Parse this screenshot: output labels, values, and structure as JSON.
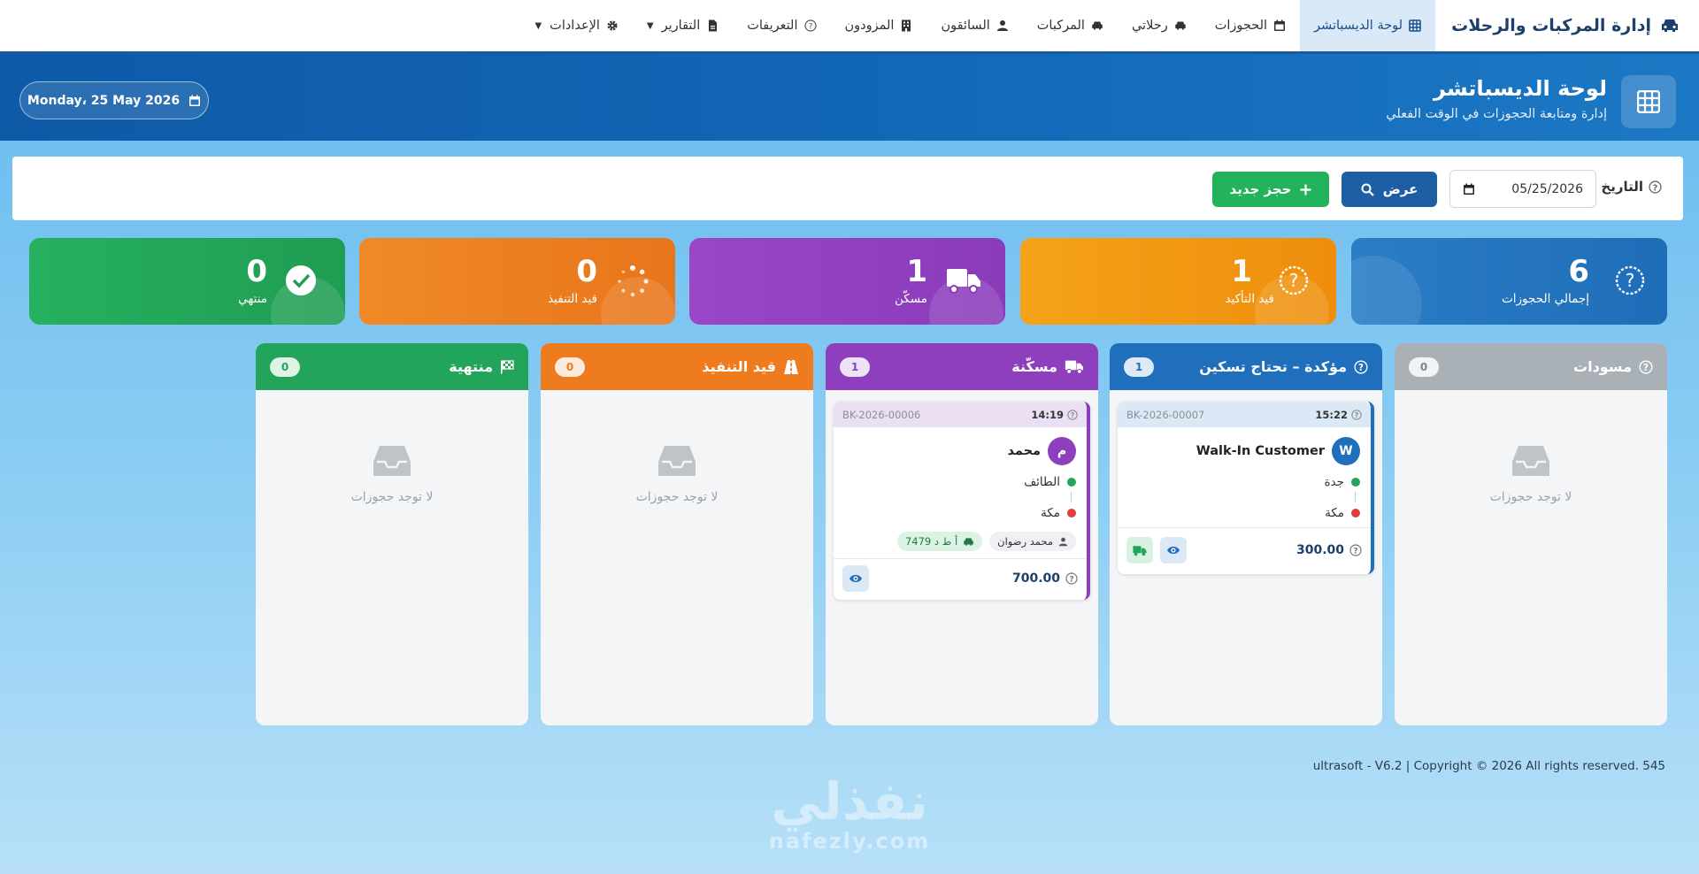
{
  "app": {
    "brand": "إدارة المركبات والرحلات",
    "nav": [
      {
        "label": "لوحة الديسباتشر",
        "icon": "grid-icon",
        "active": true
      },
      {
        "label": "الحجوزات",
        "icon": "calendar-icon"
      },
      {
        "label": "رحلاتي",
        "icon": "car-icon"
      },
      {
        "label": "المركبات",
        "icon": "car-icon"
      },
      {
        "label": "السائقون",
        "icon": "user-icon"
      },
      {
        "label": "المزودون",
        "icon": "building-icon"
      },
      {
        "label": "التعريفات",
        "icon": "question-icon"
      },
      {
        "label": "التقارير",
        "icon": "file-icon",
        "dropdown": true
      },
      {
        "label": "الإعدادات",
        "icon": "gear-icon",
        "dropdown": true
      }
    ]
  },
  "header": {
    "title": "لوحة الديسباتشر",
    "subtitle": "إدارة ومتابعة الحجوزات في الوقت الفعلي",
    "date": "Monday، 25 May 2026"
  },
  "filter": {
    "label": "التاريخ",
    "date_value": "05/25/2026",
    "show_button": "عرض",
    "new_button": "حجز جديد"
  },
  "stats": [
    {
      "value": "6",
      "label": "إجمالي الحجوزات",
      "color": "#1e73be",
      "icon": "question-circle-icon"
    },
    {
      "value": "1",
      "label": "قيد التأكيد",
      "color": "#f0960f",
      "icon": "question-circle-icon"
    },
    {
      "value": "1",
      "label": "مسكّن",
      "color": "#8e3fbd",
      "icon": "truck-icon"
    },
    {
      "value": "0",
      "label": "قيد التنفيذ",
      "color": "#ee7b1d",
      "icon": "spinner-icon"
    },
    {
      "value": "0",
      "label": "منتهي",
      "color": "#22a55a",
      "icon": "check-circle-icon"
    }
  ],
  "columns": [
    {
      "title": "مسودات",
      "count": "0",
      "color": "#a7aeb4",
      "icon": "question-icon",
      "empty_text": "لا توجد حجوزات"
    },
    {
      "title": "مؤكدة – تحتاج تسكين",
      "count": "1",
      "color": "#1f6fbd",
      "icon": "question-icon"
    },
    {
      "title": "مسكّنة",
      "count": "1",
      "color": "#8e3fbd",
      "icon": "truck-icon"
    },
    {
      "title": "قيد التنفيذ",
      "count": "0",
      "color": "#ee7b1d",
      "icon": "road-icon",
      "empty_text": "لا توجد حجوزات"
    },
    {
      "title": "منتهية",
      "count": "0",
      "color": "#22a55a",
      "icon": "flag-icon",
      "empty_text": "لا توجد حجوزات"
    }
  ],
  "cards": {
    "confirmed": {
      "time": "15:22",
      "code": "BK-2026-00007",
      "avatar": "W",
      "customer": "Walk-In Customer",
      "from": "جدة",
      "to": "مكة",
      "price": "300.00"
    },
    "assigned": {
      "time": "14:19",
      "code": "BK-2026-00006",
      "avatar": "م",
      "customer": "محمد",
      "from": "الطائف",
      "to": "مكة",
      "driver": "محمد رضوان",
      "plate": "أ ط د 7479",
      "price": "700.00"
    }
  },
  "footer": {
    "text": "ultrasoft - V6.2 | Copyright © 2026 All rights reserved. 545"
  },
  "watermark": {
    "arabic": "نفذلي",
    "latin": "nafezly.com"
  }
}
